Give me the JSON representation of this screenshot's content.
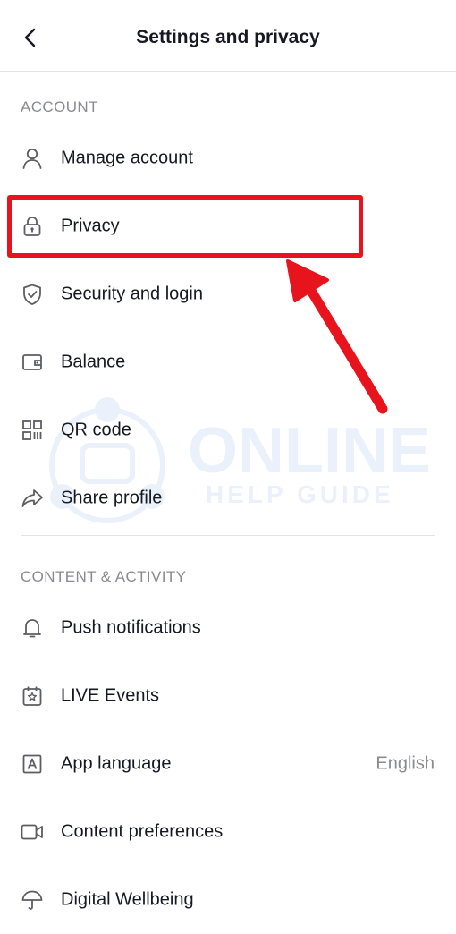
{
  "header": {
    "title": "Settings and privacy",
    "back_icon": "chevron-left-icon"
  },
  "sections": [
    {
      "label": "ACCOUNT",
      "items": [
        {
          "label": "Manage account",
          "icon": "person-icon"
        },
        {
          "label": "Privacy",
          "icon": "lock-icon"
        },
        {
          "label": "Security and login",
          "icon": "shield-icon"
        },
        {
          "label": "Balance",
          "icon": "wallet-icon"
        },
        {
          "label": "QR code",
          "icon": "qr-code-icon"
        },
        {
          "label": "Share profile",
          "icon": "share-icon"
        }
      ]
    },
    {
      "label": "CONTENT & ACTIVITY",
      "items": [
        {
          "label": "Push notifications",
          "icon": "bell-icon"
        },
        {
          "label": "LIVE Events",
          "icon": "calendar-star-icon"
        },
        {
          "label": "App language",
          "icon": "language-icon",
          "value": "English"
        },
        {
          "label": "Content preferences",
          "icon": "video-camera-icon"
        },
        {
          "label": "Digital Wellbeing",
          "icon": "umbrella-icon"
        }
      ]
    }
  ],
  "watermark": {
    "line1": "ONLINE",
    "line2": "HELP GUIDE"
  },
  "colors": {
    "highlight": "#e8141d",
    "text": "#161823",
    "muted": "#8a8b91"
  }
}
